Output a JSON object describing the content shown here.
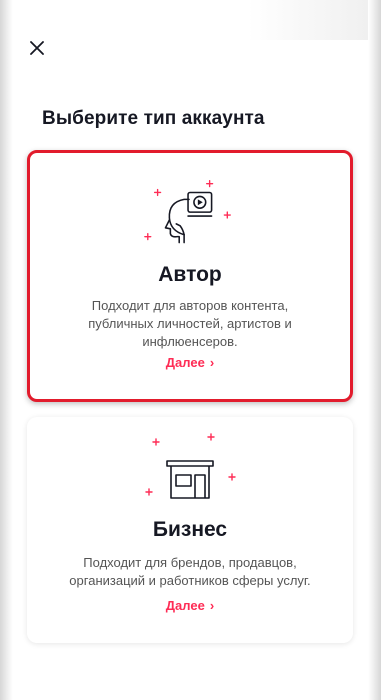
{
  "header": {
    "close_icon": "close-icon"
  },
  "title": "Выберите тип аккаунта",
  "cards": [
    {
      "id": "author",
      "icon": "creator-head-video-icon",
      "title": "Автор",
      "description": "Подходит для авторов контента, публичных личностей, артистов и инфлюенсеров.",
      "link": "Далее",
      "selected": true
    },
    {
      "id": "business",
      "icon": "storefront-icon",
      "title": "Бизнес",
      "description": "Подходит для брендов, продавцов, организаций и работников сферы услуг.",
      "link": "Далее",
      "selected": false
    }
  ],
  "colors": {
    "accent": "#fe2c55",
    "highlight_border": "#e21b2c",
    "text_primary": "#161823",
    "text_secondary": "#555555"
  }
}
